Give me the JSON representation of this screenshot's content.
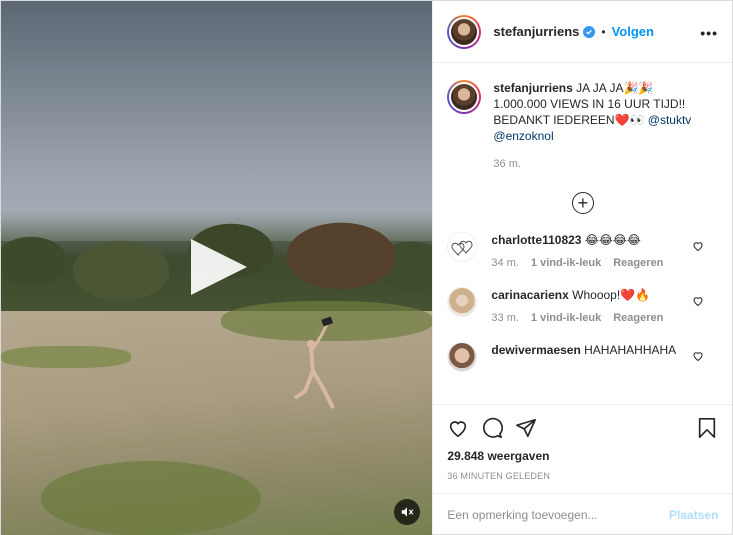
{
  "post": {
    "username": "stefanjurriens",
    "dot": "•",
    "follow_label": "Volgen",
    "more_label": "•••",
    "caption_text": "JA JA JA🎉🎉 1.000.000 VIEWS IN 16 UUR TIJD!! BEDANKT IEDEREEN❤️👀",
    "mention1": "@stuktv",
    "mention2": "@enzoknol",
    "time": "36 m."
  },
  "comments": [
    {
      "user": "charlotte110823",
      "text": "😂😂😂😂",
      "time": "34 m.",
      "likes": "1 vind-ik-leuk",
      "reply": "Reageren"
    },
    {
      "user": "carinacarienx",
      "text": "Whooop!❤️🔥",
      "time": "33 m.",
      "likes": "1 vind-ik-leuk",
      "reply": "Reageren"
    },
    {
      "user": "dewivermaesen",
      "text": "HAHAHAHHAHA"
    }
  ],
  "stats": {
    "views": "29.848 weergaven",
    "ago": "36 MINUTEN GELEDEN"
  },
  "composer": {
    "placeholder": "Een opmerking toevoegen...",
    "post_label": "Plaatsen"
  },
  "colors": {
    "link_blue": "#0095f6",
    "verified_blue": "#3897f0",
    "muted": "#8e8e8e"
  },
  "icons": [
    "play-icon",
    "mute-icon",
    "verified-icon",
    "more-icon",
    "load-more-icon",
    "heart-icon",
    "comment-icon",
    "share-icon",
    "save-icon"
  ]
}
